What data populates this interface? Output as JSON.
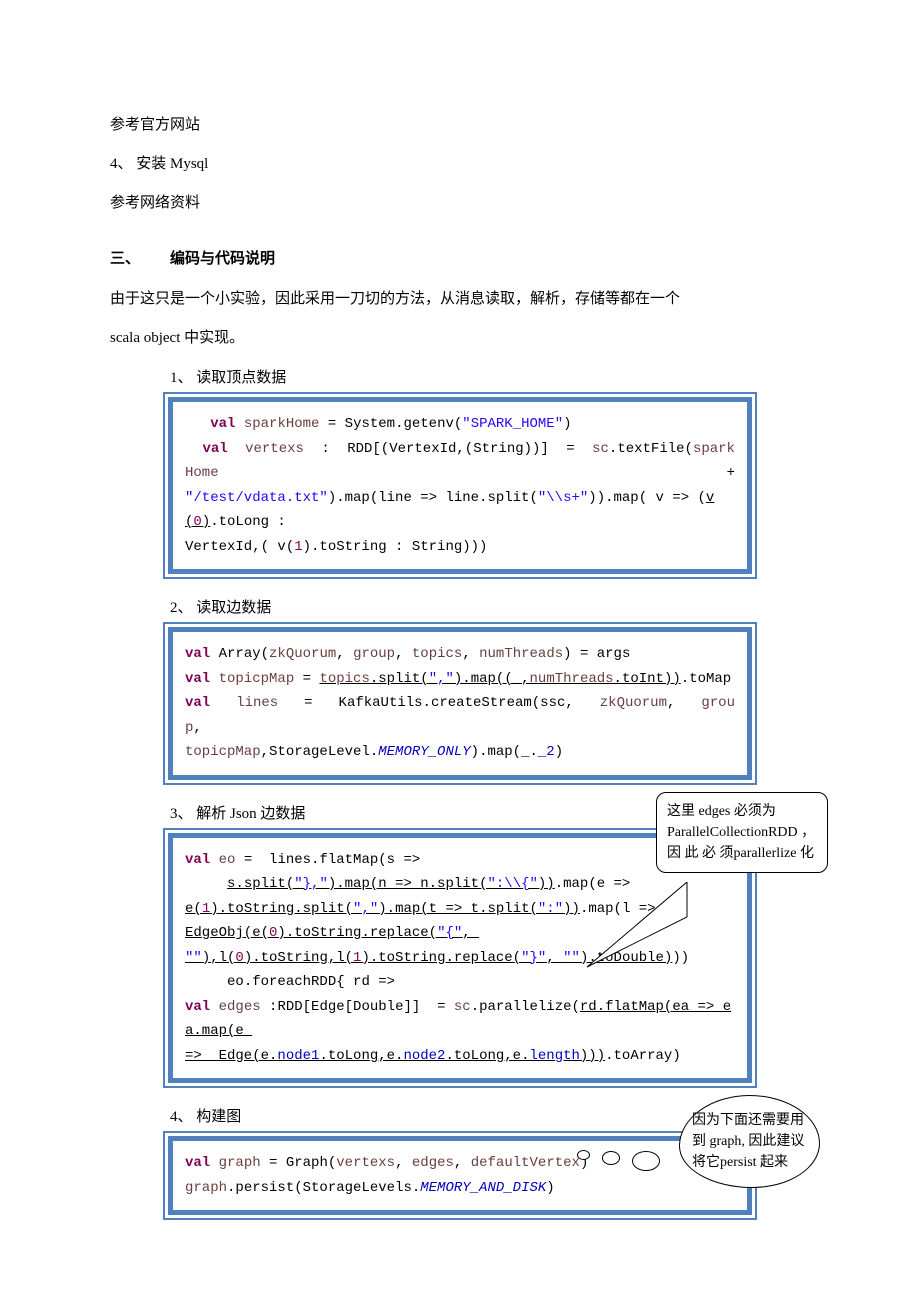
{
  "intro": {
    "l1": "参考官方网站",
    "l2": "4、 安装 Mysql",
    "l3": "参考网络资料"
  },
  "section": {
    "num": "三、",
    "title": "编码与代码说明",
    "p1": "由于这只是一个小实验，因此采用一刀切的方法，从消息读取，解析，存储等都在一个",
    "p2": "scala object 中实现。"
  },
  "item1": {
    "title": "1、 读取顶点数据",
    "code": {
      "l1a": "   ",
      "l1_kw": "val",
      "l1_sp": " ",
      "l1_id": "sparkHome",
      "l1b": " = System.getenv(",
      "l1_str": "\"SPARK_HOME\"",
      "l1c": ")",
      "l2_kw": "val",
      "l2_id": "vertexs",
      "l2a": ":",
      "l2b": "RDD[(VertexId,(String))]",
      "l2c": "=",
      "l2_id2": "sc",
      "l2d": ".textFile(",
      "l2_id3": "sparkHome",
      "l2e": "+",
      "l3_str1": "\"/test/vdata.txt\"",
      "l3a": ").map(line => line.split(",
      "l3_str2": "\"\\\\s+\"",
      "l3b": ")).map( v => (",
      "l3_u": "v(",
      "l3_n": "0",
      "l3c": ")",
      "l3d": ".toLong :",
      "l4a": "VertexId,( v(",
      "l4_n": "1",
      "l4b": ").toString : String)))"
    }
  },
  "item2": {
    "title": "2、 读取边数据",
    "code": {
      "l1_kw": "val",
      "l1a": " Array(",
      "l1_p1": "zkQuorum",
      "l1b": ", ",
      "l1_p2": "group",
      "l1c": ", ",
      "l1_p3": "topics",
      "l1d": ", ",
      "l1_p4": "numThreads",
      "l1e": ") = args",
      "l2_kw": "val",
      "l2_id": " topicpMap",
      "l2a": " = ",
      "l2_u1": "topics",
      "l2b": ".split(",
      "l2_str": "\",\"",
      "l2c": ").map((_,",
      "l2_u2": "numThreads",
      "l2d": ".toInt))",
      "l2e": ".toMap",
      "l3_kw": "val",
      "l3_id": "lines",
      "l3a": "=",
      "l3b": "KafkaUtils.createStream(ssc,",
      "l3_p1": "zkQuorum",
      "l3c": ",",
      "l3_p2": "group",
      "l3d": ",",
      "l4_id": "topicpMap",
      "l4a": ",StorageLevel.",
      "l4_s": "MEMORY_ONLY",
      "l4b": ").map(_.",
      "l4_m": "_2",
      "l4c": ")"
    }
  },
  "item3": {
    "title": "3、 解析 Json 边数据",
    "callout": "这里 edges 必须为ParallelCollectionRDD ， 因 此 必 须parallerlize 化",
    "code": {
      "l1_kw": "val",
      "l1_id": " eo",
      "l1a": " =  lines.flatMap(s => ",
      "l2a": "     ",
      "l2_u1": "s.split(",
      "l2_s1": "\"},\"",
      "l2_u2": ").map(n => n.split(",
      "l2_s2": "\":\\\\{\"",
      "l2_u3": "))",
      "l2b": ".map(e => ",
      "l3_u1": "e(",
      "l3_n1": "1",
      "l3_u2": ").toString.split(",
      "l3_s1": "\",\"",
      "l3_u3": ").map(t => t.split(",
      "l3_s2": "\":\"",
      "l3_u4": "))",
      "l3a": ".map(l => ",
      "l4_u1": "EdgeObj(e(",
      "l4_n1": "0",
      "l4_u2": ").toString.replace(",
      "l4_s1": "\"{\"",
      "l4_u3": ", ",
      "l5_s1": "\"\"",
      "l5_u1": "),l(",
      "l5_n1": "0",
      "l5_u2": ").toString,l(",
      "l5_n2": "1",
      "l5_u3": ").toString.replace(",
      "l5_s2": "\"}\"",
      "l5_u4": ", ",
      "l5_s3": "\"\"",
      "l5_u5": ").toDouble)",
      "l5a": "))",
      "l6a": "     eo.foreachRDD{ rd => ",
      "l7_kw": "val",
      "l7_id": " edges",
      "l7a": " :RDD[Edge[Double]]  = ",
      "l7_sc": "sc",
      "l7b": ".parallelize(",
      "l7_u1": "rd.flatMap(ea => ea.map(e ",
      "l8_u1": "=>  Edge(e.",
      "l8_m1": "node1",
      "l8_u2": ".toLong,e.",
      "l8_m2": "node2",
      "l8_u3": ".toLong,e.",
      "l8_m3": "length",
      "l8_u4": ")))",
      "l8a": ".toArray)"
    }
  },
  "item4": {
    "title": "4、 构建图",
    "callout": "因为下面还需要用到 graph, 因此建议将它persist 起来",
    "code": {
      "l1_kw": "val",
      "l1_id": " graph",
      "l1a": " = Graph(",
      "l1_p1": "vertexs",
      "l1b": ", ",
      "l1_p2": "edges",
      "l1c": ", ",
      "l1_p3": "defaultVertex",
      "l1d": ")",
      "l2_id": "graph",
      "l2a": ".persist(StorageLevels.",
      "l2_s": "MEMORY_AND_DISK",
      "l2b": ")"
    }
  }
}
